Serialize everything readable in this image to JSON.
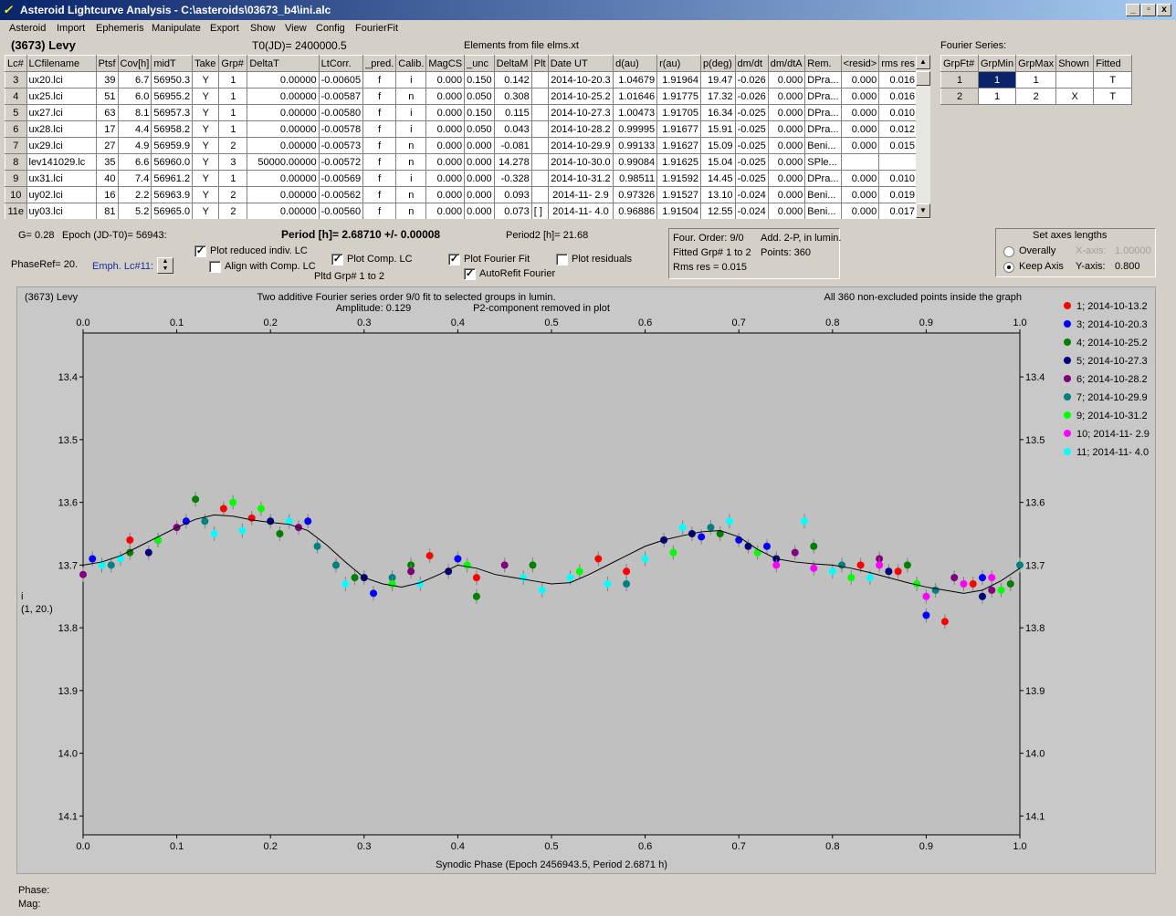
{
  "window": {
    "title": "Asteroid Lightcurve Analysis - C:\\asteroids\\03673_b4\\ini.alc",
    "icon_name": "alc-app-icon",
    "buttons": [
      "_",
      "▫",
      "x"
    ]
  },
  "menu": [
    "Asteroid",
    "Import",
    "Ephemeris",
    "Manipulate",
    "Export",
    "Show",
    "View",
    "Config",
    "FourierFit"
  ],
  "header": {
    "asteroid": "(3673) Levy",
    "t0": "T0(JD)= 2400000.5",
    "elements": "Elements from file elms.xt"
  },
  "table": {
    "columns": [
      "Lc#",
      "LCfilename",
      "Ptsf",
      "Cov[h]",
      "midT",
      "Take",
      "Grp#",
      "DeltaT",
      "LtCorr.",
      "_pred.",
      "Calib.",
      "MagCS",
      "_unc",
      "DeltaM",
      "Plt",
      "Date UT",
      "d(au)",
      "r(au)",
      "p(deg)",
      "dm/dt",
      "dm/dtA",
      "Rem.",
      "<resid>",
      "rms res"
    ],
    "rows": [
      [
        "3",
        "ux20.lci",
        "39",
        "6.7",
        "56950.3",
        "Y",
        "1",
        "0.00000",
        "-0.00605",
        "f",
        "i",
        "0.000",
        "0.150",
        "0.142",
        "",
        "2014-10-20.3",
        "1.04679",
        "1.91964",
        "19.47",
        "-0.026",
        "0.000",
        "DPra...",
        "0.000",
        "0.016"
      ],
      [
        "4",
        "ux25.lci",
        "51",
        "6.0",
        "56955.2",
        "Y",
        "1",
        "0.00000",
        "-0.00587",
        "f",
        "n",
        "0.000",
        "0.050",
        "0.308",
        "",
        "2014-10-25.2",
        "1.01646",
        "1.91775",
        "17.32",
        "-0.026",
        "0.000",
        "DPra...",
        "0.000",
        "0.016"
      ],
      [
        "5",
        "ux27.lci",
        "63",
        "8.1",
        "56957.3",
        "Y",
        "1",
        "0.00000",
        "-0.00580",
        "f",
        "i",
        "0.000",
        "0.150",
        "0.115",
        "",
        "2014-10-27.3",
        "1.00473",
        "1.91705",
        "16.34",
        "-0.025",
        "0.000",
        "DPra...",
        "0.000",
        "0.010"
      ],
      [
        "6",
        "ux28.lci",
        "17",
        "4.4",
        "56958.2",
        "Y",
        "1",
        "0.00000",
        "-0.00578",
        "f",
        "i",
        "0.000",
        "0.050",
        "0.043",
        "",
        "2014-10-28.2",
        "0.99995",
        "1.91677",
        "15.91",
        "-0.025",
        "0.000",
        "DPra...",
        "0.000",
        "0.012"
      ],
      [
        "7",
        "ux29.lci",
        "27",
        "4.9",
        "56959.9",
        "Y",
        "2",
        "0.00000",
        "-0.00573",
        "f",
        "n",
        "0.000",
        "0.000",
        "-0.081",
        "",
        "2014-10-29.9",
        "0.99133",
        "1.91627",
        "15.09",
        "-0.025",
        "0.000",
        "Beni...",
        "0.000",
        "0.015"
      ],
      [
        "8",
        "lev141029.lc",
        "35",
        "6.6",
        "56960.0",
        "Y",
        "3",
        "50000.00000",
        "-0.00572",
        "f",
        "n",
        "0.000",
        "0.000",
        "14.278",
        "",
        "2014-10-30.0",
        "0.99084",
        "1.91625",
        "15.04",
        "-0.025",
        "0.000",
        "SPle...",
        "",
        ""
      ],
      [
        "9",
        "ux31.lci",
        "40",
        "7.4",
        "56961.2",
        "Y",
        "1",
        "0.00000",
        "-0.00569",
        "f",
        "i",
        "0.000",
        "0.000",
        "-0.328",
        "",
        "2014-10-31.2",
        "0.98511",
        "1.91592",
        "14.45",
        "-0.025",
        "0.000",
        "DPra...",
        "0.000",
        "0.010"
      ],
      [
        "10",
        "uy02.lci",
        "16",
        "2.2",
        "56963.9",
        "Y",
        "2",
        "0.00000",
        "-0.00562",
        "f",
        "n",
        "0.000",
        "0.000",
        "0.093",
        "",
        "2014-11- 2.9",
        "0.97326",
        "1.91527",
        "13.10",
        "-0.024",
        "0.000",
        "Beni...",
        "0.000",
        "0.019"
      ],
      [
        "11e",
        "uy03.lci",
        "81",
        "5.2",
        "56965.0",
        "Y",
        "2",
        "0.00000",
        "-0.00560",
        "f",
        "n",
        "0.000",
        "0.000",
        "0.073",
        "[ ]",
        "2014-11- 4.0",
        "0.96886",
        "1.91504",
        "12.55",
        "-0.024",
        "0.000",
        "Beni...",
        "0.000",
        "0.017"
      ]
    ]
  },
  "fourier_panel": {
    "title": "Fourier Series:",
    "columns": [
      "GrpFt#",
      "GrpMin",
      "GrpMax",
      "Shown",
      "Fitted"
    ],
    "rows": [
      [
        "1",
        "1",
        "1",
        "",
        "T"
      ],
      [
        "2",
        "1",
        "2",
        "X",
        "T"
      ]
    ]
  },
  "info": {
    "g": "G= 0.28",
    "epoch": "Epoch (JD-T0)= 56943:",
    "period": "Period [h]= 2.68710 +/- 0.00008",
    "period2": "Period2 [h]= 21.68",
    "phaseref": "PhaseRef= 20.",
    "emph": "Emph. Lc#11:",
    "plot_reduced": "Plot reduced indiv. LC",
    "align_comp": "Align with Comp. LC",
    "plot_comp": "Plot Comp. LC",
    "pltd_grp": "Pltd Grp#  1   to   2",
    "plot_fourier": "Plot Fourier Fit",
    "autorefit": "AutoRefit Fourier",
    "plot_residuals": "Plot residuals",
    "four_order": "Four. Order:  9/0",
    "add2p": "Add. 2-P, in lumin.",
    "fitted_grp": "Fitted Grp# 1 to 2",
    "points": "Points: 360",
    "rms_res": "Rms res     = 0.015",
    "axes_title": "Set axes lengths",
    "overally": "Overally",
    "keep_axis": "Keep Axis",
    "xaxis_label": "X-axis:",
    "xaxis_val": "1.00000",
    "yaxis_label": "Y-axis:",
    "yaxis_val": "0.800"
  },
  "chart_data": {
    "type": "scatter",
    "object_label": "(3673) Levy",
    "title": "Two additive Fourier series order 9/0 fit to selected groups in lumin.",
    "amplitude": "Amplitude: 0.129",
    "p2note": "P2-component removed in plot",
    "points_note": "All 360 non-excluded points inside the graph",
    "xlabel": "Synodic Phase (Epoch 2456943.5, Period 2.6871 h)",
    "ylabel": "i",
    "ylabel2": "(1, 20.)",
    "xlim": [
      0.0,
      1.0
    ],
    "ylim": [
      14.13,
      13.33
    ],
    "yinvert": true,
    "xticks": [
      "0.0",
      "0.1",
      "0.2",
      "0.3",
      "0.4",
      "0.5",
      "0.6",
      "0.7",
      "0.8",
      "0.9",
      "1.0"
    ],
    "yticks": [
      "13.4",
      "13.5",
      "13.6",
      "13.7",
      "13.8",
      "13.9",
      "14.0",
      "14.1"
    ],
    "fit_curve": {
      "x": [
        0.0,
        0.02,
        0.04,
        0.06,
        0.08,
        0.1,
        0.12,
        0.14,
        0.16,
        0.18,
        0.2,
        0.22,
        0.24,
        0.26,
        0.28,
        0.3,
        0.32,
        0.34,
        0.36,
        0.38,
        0.4,
        0.42,
        0.44,
        0.46,
        0.48,
        0.5,
        0.52,
        0.54,
        0.56,
        0.58,
        0.6,
        0.62,
        0.64,
        0.66,
        0.68,
        0.7,
        0.72,
        0.74,
        0.76,
        0.78,
        0.8,
        0.82,
        0.84,
        0.86,
        0.88,
        0.9,
        0.92,
        0.94,
        0.96,
        0.98,
        1.0
      ],
      "y": [
        13.7,
        13.695,
        13.685,
        13.67,
        13.655,
        13.64,
        13.627,
        13.62,
        13.622,
        13.628,
        13.632,
        13.635,
        13.645,
        13.668,
        13.695,
        13.72,
        13.73,
        13.735,
        13.728,
        13.715,
        13.7,
        13.705,
        13.715,
        13.72,
        13.725,
        13.73,
        13.728,
        13.715,
        13.7,
        13.685,
        13.67,
        13.66,
        13.653,
        13.647,
        13.645,
        13.655,
        13.675,
        13.69,
        13.695,
        13.698,
        13.7,
        13.705,
        13.712,
        13.72,
        13.728,
        13.735,
        13.74,
        13.745,
        13.74,
        13.725,
        13.705
      ]
    },
    "series": [
      {
        "name": "1; 2014-10-13.2",
        "color": "#ff0000",
        "points": [
          [
            0.05,
            13.66
          ],
          [
            0.15,
            13.61
          ],
          [
            0.18,
            13.625
          ],
          [
            0.37,
            13.685
          ],
          [
            0.42,
            13.72
          ],
          [
            0.55,
            13.69
          ],
          [
            0.58,
            13.71
          ],
          [
            0.83,
            13.7
          ],
          [
            0.87,
            13.71
          ],
          [
            0.92,
            13.79
          ],
          [
            0.95,
            13.73
          ]
        ]
      },
      {
        "name": "3; 2014-10-20.3",
        "color": "#0000ff",
        "points": [
          [
            0.01,
            13.69
          ],
          [
            0.08,
            13.66
          ],
          [
            0.11,
            13.63
          ],
          [
            0.24,
            13.63
          ],
          [
            0.31,
            13.745
          ],
          [
            0.4,
            13.69
          ],
          [
            0.66,
            13.655
          ],
          [
            0.7,
            13.66
          ],
          [
            0.73,
            13.67
          ],
          [
            0.9,
            13.78
          ],
          [
            0.96,
            13.72
          ]
        ]
      },
      {
        "name": "4; 2014-10-25.2",
        "color": "#008000",
        "points": [
          [
            0.05,
            13.68
          ],
          [
            0.12,
            13.595
          ],
          [
            0.21,
            13.65
          ],
          [
            0.29,
            13.72
          ],
          [
            0.35,
            13.7
          ],
          [
            0.42,
            13.75
          ],
          [
            0.48,
            13.7
          ],
          [
            0.68,
            13.65
          ],
          [
            0.78,
            13.67
          ],
          [
            0.88,
            13.7
          ],
          [
            0.99,
            13.73
          ]
        ]
      },
      {
        "name": "5; 2014-10-27.3",
        "color": "#000080",
        "points": [
          [
            0.07,
            13.68
          ],
          [
            0.2,
            13.63
          ],
          [
            0.3,
            13.72
          ],
          [
            0.39,
            13.71
          ],
          [
            0.62,
            13.66
          ],
          [
            0.65,
            13.65
          ],
          [
            0.71,
            13.67
          ],
          [
            0.74,
            13.69
          ],
          [
            0.86,
            13.71
          ],
          [
            0.96,
            13.75
          ]
        ]
      },
      {
        "name": "6; 2014-10-28.2",
        "color": "#800080",
        "points": [
          [
            0.0,
            13.715
          ],
          [
            0.1,
            13.64
          ],
          [
            0.23,
            13.64
          ],
          [
            0.35,
            13.71
          ],
          [
            0.45,
            13.7
          ],
          [
            0.76,
            13.68
          ],
          [
            0.85,
            13.69
          ],
          [
            0.93,
            13.72
          ],
          [
            0.97,
            13.74
          ]
        ]
      },
      {
        "name": "7; 2014-10-29.9",
        "color": "#008080",
        "points": [
          [
            0.03,
            13.7
          ],
          [
            0.13,
            13.63
          ],
          [
            0.25,
            13.67
          ],
          [
            0.27,
            13.7
          ],
          [
            0.33,
            13.72
          ],
          [
            0.58,
            13.73
          ],
          [
            0.67,
            13.64
          ],
          [
            0.81,
            13.7
          ],
          [
            0.91,
            13.74
          ],
          [
            1.0,
            13.7
          ]
        ]
      },
      {
        "name": "9; 2014-10-31.2",
        "color": "#00ff00",
        "points": [
          [
            0.02,
            13.7
          ],
          [
            0.08,
            13.66
          ],
          [
            0.16,
            13.6
          ],
          [
            0.19,
            13.61
          ],
          [
            0.33,
            13.73
          ],
          [
            0.41,
            13.7
          ],
          [
            0.53,
            13.71
          ],
          [
            0.63,
            13.68
          ],
          [
            0.72,
            13.68
          ],
          [
            0.82,
            13.72
          ],
          [
            0.89,
            13.73
          ],
          [
            0.98,
            13.74
          ]
        ]
      },
      {
        "name": "10; 2014-11- 2.9",
        "color": "#ff00ff",
        "points": [
          [
            0.74,
            13.7
          ],
          [
            0.78,
            13.705
          ],
          [
            0.85,
            13.7
          ],
          [
            0.9,
            13.75
          ],
          [
            0.94,
            13.73
          ],
          [
            0.97,
            13.72
          ]
        ]
      },
      {
        "name": "11; 2014-11- 4.0",
        "color": "#00ffff",
        "points": [
          [
            0.02,
            13.7
          ],
          [
            0.04,
            13.69
          ],
          [
            0.14,
            13.65
          ],
          [
            0.17,
            13.645
          ],
          [
            0.22,
            13.63
          ],
          [
            0.28,
            13.73
          ],
          [
            0.36,
            13.73
          ],
          [
            0.47,
            13.72
          ],
          [
            0.49,
            13.74
          ],
          [
            0.52,
            13.72
          ],
          [
            0.56,
            13.73
          ],
          [
            0.6,
            13.69
          ],
          [
            0.64,
            13.64
          ],
          [
            0.69,
            13.63
          ],
          [
            0.77,
            13.63
          ],
          [
            0.8,
            13.71
          ],
          [
            0.84,
            13.72
          ]
        ]
      }
    ]
  },
  "footer": {
    "phase": "Phase:",
    "mag": "Mag:"
  }
}
